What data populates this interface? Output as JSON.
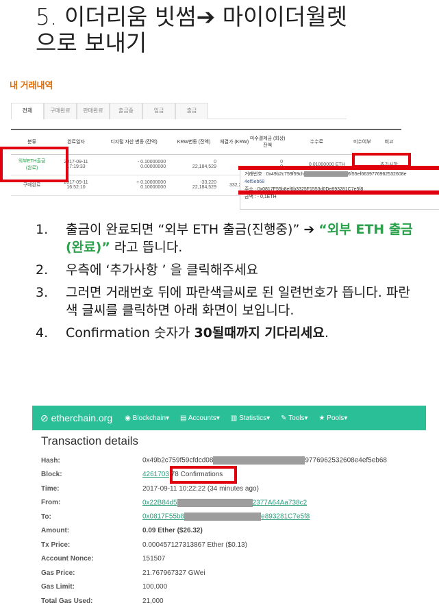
{
  "slide": {
    "title_line1": "5. 이더리움 빗썸➔ 마이이더월렛",
    "title_line2": "으로 보내기"
  },
  "history": {
    "title": "내 거래내역",
    "tabs": [
      "전체",
      "구매완료",
      "판매완료",
      "출금중",
      "입금",
      "출금"
    ],
    "columns": [
      "분류",
      "완료일자",
      "디지털 자산 변동\n(잔액)",
      "KRW변동\n(잔액)",
      "체결가\n(KRW)",
      "미수결제금\n(회상)잔액",
      "수수료",
      "미수여부",
      "비고"
    ],
    "rows": [
      {
        "type": "외부ETH출금\n(완료)",
        "date": "2017-09-11\n17:19:33",
        "asset": "- 0.10000000\n0.00000000",
        "krw": "0\n22,184,529",
        "price": "",
        "unpaid": "0\n0",
        "fee": "0.01000000 ETH",
        "status": "",
        "note": "추가사항"
      },
      {
        "type": "구매완료",
        "date": "2017-09-11\n16:52:10",
        "asset": "+ 0.10000000\n0.10000000",
        "krw": "-33,220\n22,184,529",
        "price": "332,200",
        "unpaid": "0\n0",
        "fee": "",
        "status": "",
        "note": ""
      }
    ],
    "popup": {
      "line1_label": "거래번호 : 0x49b2c759f59ch",
      "line1_suffix": "6f55ef6639776962532608e",
      "line2": "4ef5eb68",
      "line3": "주소 : 0x0817F55b8ef6b3325F1553d0De893281C7e5f8",
      "line4": "금액 : - 0,1ETH"
    }
  },
  "steps": [
    {
      "num": "1.",
      "text_a": "출금이 완료되면 “외부 ETH 출금(진행중)”  ➔ ",
      "highlight": "“외부 ETH 출금(완료)”",
      "text_b": " 라고 뜹니다."
    },
    {
      "num": "2.",
      "text_a": "우측에 ‘추가사항 ’ 을 클릭해주세요",
      "highlight": "",
      "text_b": ""
    },
    {
      "num": "3.",
      "text_a": "그러면 거래번호 뒤에 파란색글씨로 된 일련번호가 뜹니다. 파란색 글씨를 클릭하면 아래 화면이 보입니다.",
      "highlight": "",
      "text_b": ""
    },
    {
      "num": "4.",
      "text_a": "Confirmation 숫자가 ",
      "highlight": "30될때까지 기다리세요",
      "text_b": "."
    }
  ],
  "etherchain": {
    "brand": "etherchain.org",
    "menu": [
      "Blockchain▾",
      "Accounts▾",
      "Statistics▾",
      "Tools▾",
      "Pools▾"
    ],
    "title": "Transaction details",
    "rows": [
      {
        "label": "Hash:",
        "value_a": "0x49b2c759f59cfdcd08",
        "value_b": "9776962532608e4ef5eb68",
        "link": false
      },
      {
        "label": "Block:",
        "value_a": "4261703",
        "value_b": "78 Confirmations",
        "link": true
      },
      {
        "label": "Time:",
        "value_a": "2017-09-11 10:22:22 (34 minutes ago)",
        "value_b": "",
        "link": false
      },
      {
        "label": "From:",
        "value_a": "0x22B84d5",
        "value_b": "2377A64Aa738c2",
        "link": true
      },
      {
        "label": "To:",
        "value_a": "0x0817F55b8",
        "value_b": "e893281C7e5f8",
        "link": true
      },
      {
        "label": "Amount:",
        "value_a": "0.09 Ether ($26.32)",
        "value_b": "",
        "link": false
      },
      {
        "label": "Tx Price:",
        "value_a": "0.000457127313867 Ether ($0.13)",
        "value_b": "",
        "link": false
      },
      {
        "label": "Account Nonce:",
        "value_a": "151507",
        "value_b": "",
        "link": false
      },
      {
        "label": "Gas Price:",
        "value_a": "21.767967327 GWei",
        "value_b": "",
        "link": false
      },
      {
        "label": "Gas Limit:",
        "value_a": "100,000",
        "value_b": "",
        "link": false
      },
      {
        "label": "Total Gas Used:",
        "value_a": "21,000",
        "value_b": "",
        "link": false
      }
    ]
  }
}
